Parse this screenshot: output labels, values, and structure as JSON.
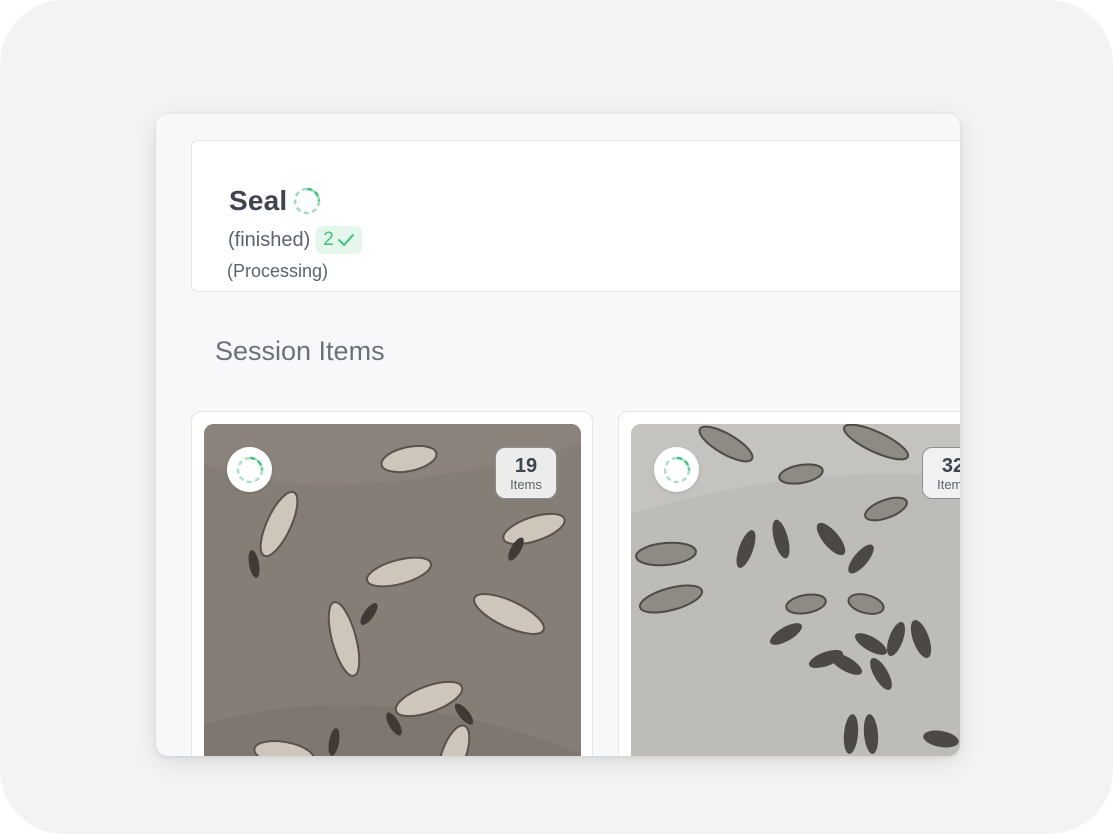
{
  "session": {
    "title": "Seal",
    "status": "(finished)",
    "finished_count": "2",
    "processing": "(Processing)"
  },
  "section_title": "Session Items",
  "items": [
    {
      "count": "19",
      "label": "Items"
    },
    {
      "count": "32",
      "label": "Items"
    }
  ],
  "colors": {
    "accent_green": "#3ec27a",
    "badge_bg": "#e5f7ec",
    "text_dark": "#3f4450"
  },
  "icons": {
    "spinner": "progress-spinner-icon",
    "check": "check-icon"
  }
}
